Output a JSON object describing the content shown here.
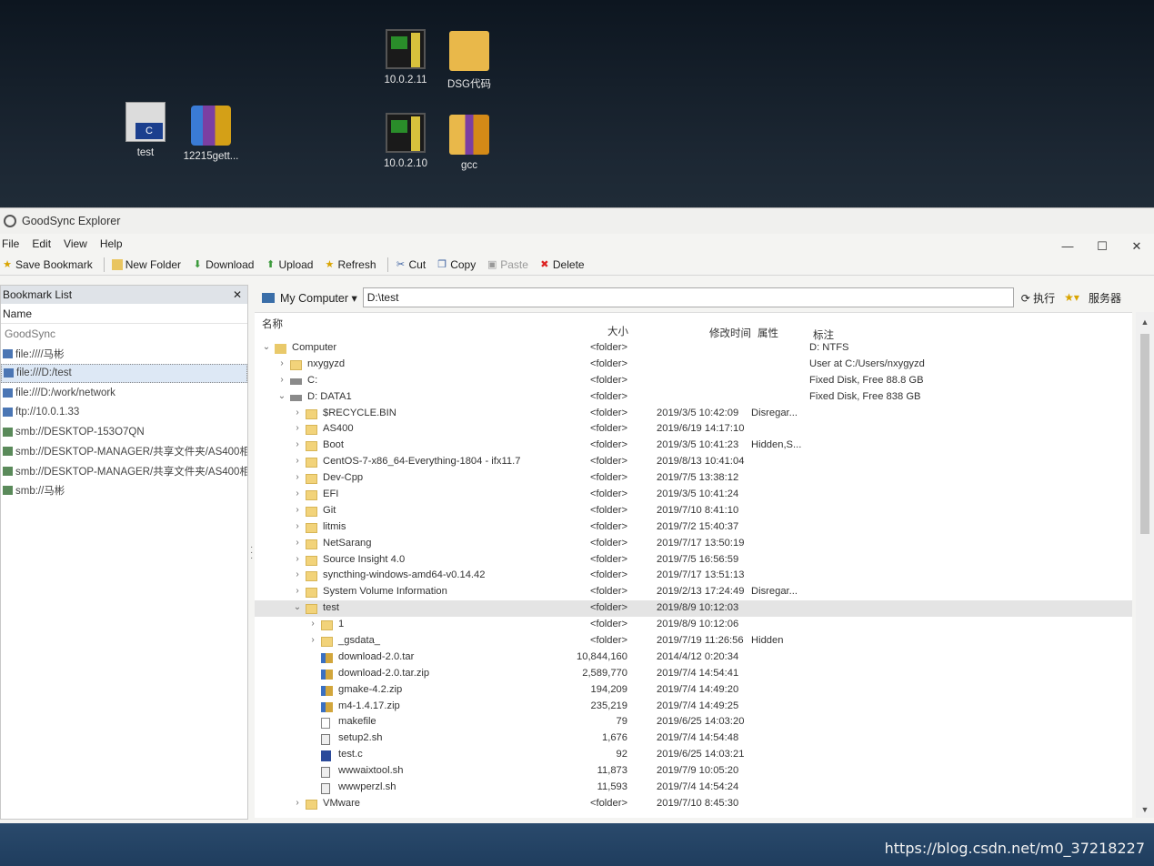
{
  "desktop": {
    "icons": [
      {
        "label": "test",
        "icon": "c-source-file-icon"
      },
      {
        "label": "12215gett...",
        "icon": "archive-icon"
      },
      {
        "label": "10.0.2.11",
        "icon": "remote-desktop-icon"
      },
      {
        "label": "DSG代码",
        "icon": "folder-icon"
      },
      {
        "label": "10.0.2.10",
        "icon": "remote-desktop-icon"
      },
      {
        "label": "gcc",
        "icon": "folder-icon"
      }
    ]
  },
  "window": {
    "title": "GoodSync Explorer",
    "controls": {
      "minimize": "—",
      "maximize": "☐",
      "close": "✕"
    }
  },
  "menu": [
    "File",
    "Edit",
    "View",
    "Help"
  ],
  "toolbar": {
    "save_bookmark": "Save Bookmark",
    "new_folder": "New Folder",
    "download": "Download",
    "upload": "Upload",
    "refresh": "Refresh",
    "cut": "Cut",
    "copy": "Copy",
    "paste": "Paste",
    "delete": "Delete"
  },
  "bookmarks": {
    "title": "Bookmark List",
    "close": "✕",
    "column": "Name",
    "group": "GoodSync",
    "items": [
      "file:////马彬",
      "file:///D:/test",
      "file:///D:/work/network",
      "ftp://10.0.1.33",
      "smb://DESKTOP-153O7QN",
      "smb://DESKTOP-MANAGER/共享文件夹/AS400相",
      "smb://DESKTOP-MANAGER/共享文件夹/AS400相",
      "smb://马彬"
    ],
    "selected_index": 1
  },
  "address": {
    "location": "My Computer ▾",
    "path": "D:\\test",
    "go": "⟳ 执行",
    "star": "★▾",
    "server": "服务器"
  },
  "columns": {
    "name": "名称",
    "size": "大小",
    "modified": "修改时间",
    "attr": "属性",
    "note": "标注"
  },
  "rows": [
    {
      "indent": 0,
      "chev": "⌄",
      "icon": "pc",
      "name": "Computer",
      "size": "<folder>",
      "date": "",
      "attr": "",
      "note": "D: NTFS"
    },
    {
      "indent": 1,
      "chev": "›",
      "icon": "folder",
      "name": "nxygyzd",
      "size": "<folder>",
      "date": "",
      "attr": "",
      "note": "User at C:/Users/nxygyzd"
    },
    {
      "indent": 1,
      "chev": "›",
      "icon": "drive",
      "name": "C:",
      "size": "<folder>",
      "date": "",
      "attr": "",
      "note": "Fixed Disk, Free 88.8 GB"
    },
    {
      "indent": 1,
      "chev": "⌄",
      "icon": "drive",
      "name": "D: DATA1",
      "size": "<folder>",
      "date": "",
      "attr": "",
      "note": "Fixed Disk, Free 838 GB"
    },
    {
      "indent": 2,
      "chev": "›",
      "icon": "folder",
      "name": "$RECYCLE.BIN",
      "size": "<folder>",
      "date": "2019/3/5 10:42:09",
      "attr": "Disregar...",
      "note": ""
    },
    {
      "indent": 2,
      "chev": "›",
      "icon": "folder",
      "name": "AS400",
      "size": "<folder>",
      "date": "2019/6/19 14:17:10",
      "attr": "",
      "note": ""
    },
    {
      "indent": 2,
      "chev": "›",
      "icon": "folder",
      "name": "Boot",
      "size": "<folder>",
      "date": "2019/3/5 10:41:23",
      "attr": "Hidden,S...",
      "note": ""
    },
    {
      "indent": 2,
      "chev": "›",
      "icon": "folder",
      "name": "CentOS-7-x86_64-Everything-1804 - ifx11.7",
      "size": "<folder>",
      "date": "2019/8/13 10:41:04",
      "attr": "",
      "note": ""
    },
    {
      "indent": 2,
      "chev": "›",
      "icon": "folder",
      "name": "Dev-Cpp",
      "size": "<folder>",
      "date": "2019/7/5 13:38:12",
      "attr": "",
      "note": ""
    },
    {
      "indent": 2,
      "chev": "›",
      "icon": "folder",
      "name": "EFI",
      "size": "<folder>",
      "date": "2019/3/5 10:41:24",
      "attr": "",
      "note": ""
    },
    {
      "indent": 2,
      "chev": "›",
      "icon": "folder",
      "name": "Git",
      "size": "<folder>",
      "date": "2019/7/10 8:41:10",
      "attr": "",
      "note": ""
    },
    {
      "indent": 2,
      "chev": "›",
      "icon": "folder",
      "name": "litmis",
      "size": "<folder>",
      "date": "2019/7/2 15:40:37",
      "attr": "",
      "note": ""
    },
    {
      "indent": 2,
      "chev": "›",
      "icon": "folder",
      "name": "NetSarang",
      "size": "<folder>",
      "date": "2019/7/17 13:50:19",
      "attr": "",
      "note": ""
    },
    {
      "indent": 2,
      "chev": "›",
      "icon": "folder",
      "name": "Source Insight 4.0",
      "size": "<folder>",
      "date": "2019/7/5 16:56:59",
      "attr": "",
      "note": ""
    },
    {
      "indent": 2,
      "chev": "›",
      "icon": "folder",
      "name": "syncthing-windows-amd64-v0.14.42",
      "size": "<folder>",
      "date": "2019/7/17 13:51:13",
      "attr": "",
      "note": ""
    },
    {
      "indent": 2,
      "chev": "›",
      "icon": "folder",
      "name": "System Volume Information",
      "size": "<folder>",
      "date": "2019/2/13 17:24:49",
      "attr": "Disregar...",
      "note": ""
    },
    {
      "indent": 2,
      "chev": "⌄",
      "icon": "folder",
      "name": "test",
      "size": "<folder>",
      "date": "2019/8/9 10:12:03",
      "attr": "",
      "note": "",
      "selected": true
    },
    {
      "indent": 3,
      "chev": "›",
      "icon": "folder",
      "name": "1",
      "size": "<folder>",
      "date": "2019/8/9 10:12:06",
      "attr": "",
      "note": ""
    },
    {
      "indent": 3,
      "chev": "›",
      "icon": "folder",
      "name": "_gsdata_",
      "size": "<folder>",
      "date": "2019/7/19 11:26:56",
      "attr": "Hidden",
      "note": ""
    },
    {
      "indent": 3,
      "chev": "",
      "icon": "archive",
      "name": "download-2.0.tar",
      "size": "10,844,160",
      "date": "2014/4/12 0:20:34",
      "attr": "",
      "note": ""
    },
    {
      "indent": 3,
      "chev": "",
      "icon": "archive",
      "name": "download-2.0.tar.zip",
      "size": "2,589,770",
      "date": "2019/7/4 14:54:41",
      "attr": "",
      "note": ""
    },
    {
      "indent": 3,
      "chev": "",
      "icon": "archive",
      "name": "gmake-4.2.zip",
      "size": "194,209",
      "date": "2019/7/4 14:49:20",
      "attr": "",
      "note": ""
    },
    {
      "indent": 3,
      "chev": "",
      "icon": "archive",
      "name": "m4-1.4.17.zip",
      "size": "235,219",
      "date": "2019/7/4 14:49:25",
      "attr": "",
      "note": ""
    },
    {
      "indent": 3,
      "chev": "",
      "icon": "file",
      "name": "makefile",
      "size": "79",
      "date": "2019/6/25 14:03:20",
      "attr": "",
      "note": ""
    },
    {
      "indent": 3,
      "chev": "",
      "icon": "script",
      "name": "setup2.sh",
      "size": "1,676",
      "date": "2019/7/4 14:54:48",
      "attr": "",
      "note": ""
    },
    {
      "indent": 3,
      "chev": "",
      "icon": "cfile",
      "name": "test.c",
      "size": "92",
      "date": "2019/6/25 14:03:21",
      "attr": "",
      "note": ""
    },
    {
      "indent": 3,
      "chev": "",
      "icon": "script",
      "name": "wwwaixtool.sh",
      "size": "11,873",
      "date": "2019/7/9 10:05:20",
      "attr": "",
      "note": ""
    },
    {
      "indent": 3,
      "chev": "",
      "icon": "script",
      "name": "wwwperzl.sh",
      "size": "11,593",
      "date": "2019/7/4 14:54:24",
      "attr": "",
      "note": ""
    },
    {
      "indent": 2,
      "chev": "›",
      "icon": "folder",
      "name": "VMware",
      "size": "<folder>",
      "date": "2019/7/10 8:45:30",
      "attr": "",
      "note": ""
    }
  ],
  "watermark": "https://blog.csdn.net/m0_37218227"
}
